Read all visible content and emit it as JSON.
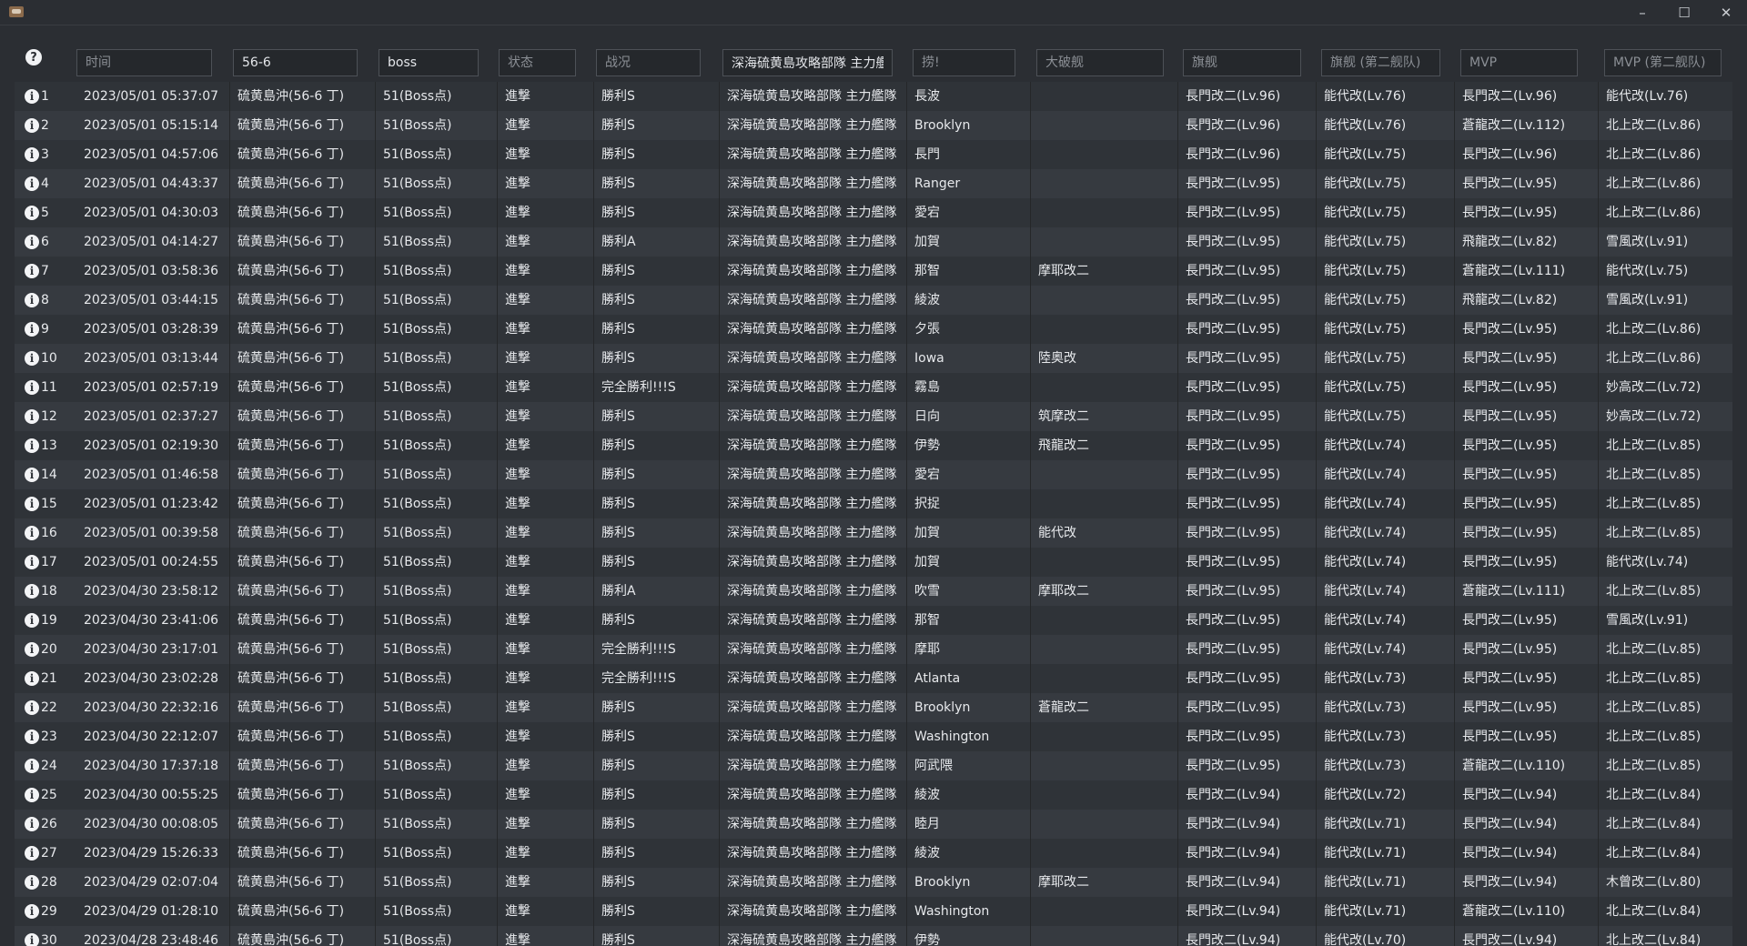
{
  "window": {
    "minimize_icon": "minimize-icon",
    "maximize_icon": "maximize-icon",
    "close_icon": "close-icon",
    "minimize": "–",
    "maximize": "☐",
    "close": "✕"
  },
  "filters": [
    {
      "name": "time",
      "placeholder": "时间",
      "value": ""
    },
    {
      "name": "map",
      "placeholder": "",
      "value": "56-6"
    },
    {
      "name": "node",
      "placeholder": "",
      "value": "boss"
    },
    {
      "name": "status",
      "placeholder": "状态",
      "value": ""
    },
    {
      "name": "result",
      "placeholder": "战况",
      "value": ""
    },
    {
      "name": "enemy",
      "placeholder": "",
      "value": "深海硫黄島攻略部隊 主力艦"
    },
    {
      "name": "drop",
      "placeholder": "捞!",
      "value": ""
    },
    {
      "name": "damaged",
      "placeholder": "大破舰",
      "value": ""
    },
    {
      "name": "flagship",
      "placeholder": "旗舰",
      "value": ""
    },
    {
      "name": "flagship2",
      "placeholder": "旗舰 (第二舰队)",
      "value": ""
    },
    {
      "name": "mvp",
      "placeholder": "MVP",
      "value": ""
    },
    {
      "name": "mvp2",
      "placeholder": "MVP (第二舰队)",
      "value": ""
    }
  ],
  "help_icon": "?",
  "info_icon": "i",
  "rows": [
    {
      "n": "1",
      "time": "2023/05/01 05:37:07",
      "map": "硫黄島沖(56-6 丁)",
      "node": "51(Boss点)",
      "status": "進撃",
      "result": "勝利S",
      "enemy": "深海硫黄島攻略部隊 主力艦隊",
      "drop": "長波",
      "damaged": "",
      "flag": "長門改二(Lv.96)",
      "flag2": "能代改(Lv.76)",
      "mvp": "長門改二(Lv.96)",
      "mvp2": "能代改(Lv.76)"
    },
    {
      "n": "2",
      "time": "2023/05/01 05:15:14",
      "map": "硫黄島沖(56-6 丁)",
      "node": "51(Boss点)",
      "status": "進撃",
      "result": "勝利S",
      "enemy": "深海硫黄島攻略部隊 主力艦隊",
      "drop": "Brooklyn",
      "damaged": "",
      "flag": "長門改二(Lv.96)",
      "flag2": "能代改(Lv.76)",
      "mvp": "蒼龍改二(Lv.112)",
      "mvp2": "北上改二(Lv.86)"
    },
    {
      "n": "3",
      "time": "2023/05/01 04:57:06",
      "map": "硫黄島沖(56-6 丁)",
      "node": "51(Boss点)",
      "status": "進撃",
      "result": "勝利S",
      "enemy": "深海硫黄島攻略部隊 主力艦隊",
      "drop": "長門",
      "damaged": "",
      "flag": "長門改二(Lv.96)",
      "flag2": "能代改(Lv.75)",
      "mvp": "長門改二(Lv.96)",
      "mvp2": "北上改二(Lv.86)"
    },
    {
      "n": "4",
      "time": "2023/05/01 04:43:37",
      "map": "硫黄島沖(56-6 丁)",
      "node": "51(Boss点)",
      "status": "進撃",
      "result": "勝利S",
      "enemy": "深海硫黄島攻略部隊 主力艦隊",
      "drop": "Ranger",
      "damaged": "",
      "flag": "長門改二(Lv.95)",
      "flag2": "能代改(Lv.75)",
      "mvp": "長門改二(Lv.95)",
      "mvp2": "北上改二(Lv.86)"
    },
    {
      "n": "5",
      "time": "2023/05/01 04:30:03",
      "map": "硫黄島沖(56-6 丁)",
      "node": "51(Boss点)",
      "status": "進撃",
      "result": "勝利S",
      "enemy": "深海硫黄島攻略部隊 主力艦隊",
      "drop": "愛宕",
      "damaged": "",
      "flag": "長門改二(Lv.95)",
      "flag2": "能代改(Lv.75)",
      "mvp": "長門改二(Lv.95)",
      "mvp2": "北上改二(Lv.86)"
    },
    {
      "n": "6",
      "time": "2023/05/01 04:14:27",
      "map": "硫黄島沖(56-6 丁)",
      "node": "51(Boss点)",
      "status": "進撃",
      "result": "勝利A",
      "enemy": "深海硫黄島攻略部隊 主力艦隊",
      "drop": "加賀",
      "damaged": "",
      "flag": "長門改二(Lv.95)",
      "flag2": "能代改(Lv.75)",
      "mvp": "飛龍改二(Lv.82)",
      "mvp2": "雪風改(Lv.91)"
    },
    {
      "n": "7",
      "time": "2023/05/01 03:58:36",
      "map": "硫黄島沖(56-6 丁)",
      "node": "51(Boss点)",
      "status": "進撃",
      "result": "勝利S",
      "enemy": "深海硫黄島攻略部隊 主力艦隊",
      "drop": "那智",
      "damaged": "摩耶改二",
      "flag": "長門改二(Lv.95)",
      "flag2": "能代改(Lv.75)",
      "mvp": "蒼龍改二(Lv.111)",
      "mvp2": "能代改(Lv.75)"
    },
    {
      "n": "8",
      "time": "2023/05/01 03:44:15",
      "map": "硫黄島沖(56-6 丁)",
      "node": "51(Boss点)",
      "status": "進撃",
      "result": "勝利S",
      "enemy": "深海硫黄島攻略部隊 主力艦隊",
      "drop": "綾波",
      "damaged": "",
      "flag": "長門改二(Lv.95)",
      "flag2": "能代改(Lv.75)",
      "mvp": "飛龍改二(Lv.82)",
      "mvp2": "雪風改(Lv.91)"
    },
    {
      "n": "9",
      "time": "2023/05/01 03:28:39",
      "map": "硫黄島沖(56-6 丁)",
      "node": "51(Boss点)",
      "status": "進撃",
      "result": "勝利S",
      "enemy": "深海硫黄島攻略部隊 主力艦隊",
      "drop": "夕張",
      "damaged": "",
      "flag": "長門改二(Lv.95)",
      "flag2": "能代改(Lv.75)",
      "mvp": "長門改二(Lv.95)",
      "mvp2": "北上改二(Lv.86)"
    },
    {
      "n": "10",
      "time": "2023/05/01 03:13:44",
      "map": "硫黄島沖(56-6 丁)",
      "node": "51(Boss点)",
      "status": "進撃",
      "result": "勝利S",
      "enemy": "深海硫黄島攻略部隊 主力艦隊",
      "drop": "Iowa",
      "damaged": "陸奥改",
      "flag": "長門改二(Lv.95)",
      "flag2": "能代改(Lv.75)",
      "mvp": "長門改二(Lv.95)",
      "mvp2": "北上改二(Lv.86)"
    },
    {
      "n": "11",
      "time": "2023/05/01 02:57:19",
      "map": "硫黄島沖(56-6 丁)",
      "node": "51(Boss点)",
      "status": "進撃",
      "result": "完全勝利!!!S",
      "enemy": "深海硫黄島攻略部隊 主力艦隊",
      "drop": "霧島",
      "damaged": "",
      "flag": "長門改二(Lv.95)",
      "flag2": "能代改(Lv.75)",
      "mvp": "長門改二(Lv.95)",
      "mvp2": "妙高改二(Lv.72)"
    },
    {
      "n": "12",
      "time": "2023/05/01 02:37:27",
      "map": "硫黄島沖(56-6 丁)",
      "node": "51(Boss点)",
      "status": "進撃",
      "result": "勝利S",
      "enemy": "深海硫黄島攻略部隊 主力艦隊",
      "drop": "日向",
      "damaged": "筑摩改二",
      "flag": "長門改二(Lv.95)",
      "flag2": "能代改(Lv.75)",
      "mvp": "長門改二(Lv.95)",
      "mvp2": "妙高改二(Lv.72)"
    },
    {
      "n": "13",
      "time": "2023/05/01 02:19:30",
      "map": "硫黄島沖(56-6 丁)",
      "node": "51(Boss点)",
      "status": "進撃",
      "result": "勝利S",
      "enemy": "深海硫黄島攻略部隊 主力艦隊",
      "drop": "伊勢",
      "damaged": "飛龍改二",
      "flag": "長門改二(Lv.95)",
      "flag2": "能代改(Lv.74)",
      "mvp": "長門改二(Lv.95)",
      "mvp2": "北上改二(Lv.85)"
    },
    {
      "n": "14",
      "time": "2023/05/01 01:46:58",
      "map": "硫黄島沖(56-6 丁)",
      "node": "51(Boss点)",
      "status": "進撃",
      "result": "勝利S",
      "enemy": "深海硫黄島攻略部隊 主力艦隊",
      "drop": "愛宕",
      "damaged": "",
      "flag": "長門改二(Lv.95)",
      "flag2": "能代改(Lv.74)",
      "mvp": "長門改二(Lv.95)",
      "mvp2": "北上改二(Lv.85)"
    },
    {
      "n": "15",
      "time": "2023/05/01 01:23:42",
      "map": "硫黄島沖(56-6 丁)",
      "node": "51(Boss点)",
      "status": "進撃",
      "result": "勝利S",
      "enemy": "深海硫黄島攻略部隊 主力艦隊",
      "drop": "択捉",
      "damaged": "",
      "flag": "長門改二(Lv.95)",
      "flag2": "能代改(Lv.74)",
      "mvp": "長門改二(Lv.95)",
      "mvp2": "北上改二(Lv.85)"
    },
    {
      "n": "16",
      "time": "2023/05/01 00:39:58",
      "map": "硫黄島沖(56-6 丁)",
      "node": "51(Boss点)",
      "status": "進撃",
      "result": "勝利S",
      "enemy": "深海硫黄島攻略部隊 主力艦隊",
      "drop": "加賀",
      "damaged": "能代改",
      "flag": "長門改二(Lv.95)",
      "flag2": "能代改(Lv.74)",
      "mvp": "長門改二(Lv.95)",
      "mvp2": "北上改二(Lv.85)"
    },
    {
      "n": "17",
      "time": "2023/05/01 00:24:55",
      "map": "硫黄島沖(56-6 丁)",
      "node": "51(Boss点)",
      "status": "進撃",
      "result": "勝利S",
      "enemy": "深海硫黄島攻略部隊 主力艦隊",
      "drop": "加賀",
      "damaged": "",
      "flag": "長門改二(Lv.95)",
      "flag2": "能代改(Lv.74)",
      "mvp": "長門改二(Lv.95)",
      "mvp2": "能代改(Lv.74)"
    },
    {
      "n": "18",
      "time": "2023/04/30 23:58:12",
      "map": "硫黄島沖(56-6 丁)",
      "node": "51(Boss点)",
      "status": "進撃",
      "result": "勝利A",
      "enemy": "深海硫黄島攻略部隊 主力艦隊",
      "drop": "吹雪",
      "damaged": "摩耶改二",
      "flag": "長門改二(Lv.95)",
      "flag2": "能代改(Lv.74)",
      "mvp": "蒼龍改二(Lv.111)",
      "mvp2": "北上改二(Lv.85)"
    },
    {
      "n": "19",
      "time": "2023/04/30 23:41:06",
      "map": "硫黄島沖(56-6 丁)",
      "node": "51(Boss点)",
      "status": "進撃",
      "result": "勝利S",
      "enemy": "深海硫黄島攻略部隊 主力艦隊",
      "drop": "那智",
      "damaged": "",
      "flag": "長門改二(Lv.95)",
      "flag2": "能代改(Lv.74)",
      "mvp": "長門改二(Lv.95)",
      "mvp2": "雪風改(Lv.91)"
    },
    {
      "n": "20",
      "time": "2023/04/30 23:17:01",
      "map": "硫黄島沖(56-6 丁)",
      "node": "51(Boss点)",
      "status": "進撃",
      "result": "完全勝利!!!S",
      "enemy": "深海硫黄島攻略部隊 主力艦隊",
      "drop": "摩耶",
      "damaged": "",
      "flag": "長門改二(Lv.95)",
      "flag2": "能代改(Lv.74)",
      "mvp": "長門改二(Lv.95)",
      "mvp2": "北上改二(Lv.85)"
    },
    {
      "n": "21",
      "time": "2023/04/30 23:02:28",
      "map": "硫黄島沖(56-6 丁)",
      "node": "51(Boss点)",
      "status": "進撃",
      "result": "完全勝利!!!S",
      "enemy": "深海硫黄島攻略部隊 主力艦隊",
      "drop": "Atlanta",
      "damaged": "",
      "flag": "長門改二(Lv.95)",
      "flag2": "能代改(Lv.73)",
      "mvp": "長門改二(Lv.95)",
      "mvp2": "北上改二(Lv.85)"
    },
    {
      "n": "22",
      "time": "2023/04/30 22:32:16",
      "map": "硫黄島沖(56-6 丁)",
      "node": "51(Boss点)",
      "status": "進撃",
      "result": "勝利S",
      "enemy": "深海硫黄島攻略部隊 主力艦隊",
      "drop": "Brooklyn",
      "damaged": "蒼龍改二",
      "flag": "長門改二(Lv.95)",
      "flag2": "能代改(Lv.73)",
      "mvp": "長門改二(Lv.95)",
      "mvp2": "北上改二(Lv.85)"
    },
    {
      "n": "23",
      "time": "2023/04/30 22:12:07",
      "map": "硫黄島沖(56-6 丁)",
      "node": "51(Boss点)",
      "status": "進撃",
      "result": "勝利S",
      "enemy": "深海硫黄島攻略部隊 主力艦隊",
      "drop": "Washington",
      "damaged": "",
      "flag": "長門改二(Lv.95)",
      "flag2": "能代改(Lv.73)",
      "mvp": "長門改二(Lv.95)",
      "mvp2": "北上改二(Lv.85)"
    },
    {
      "n": "24",
      "time": "2023/04/30 17:37:18",
      "map": "硫黄島沖(56-6 丁)",
      "node": "51(Boss点)",
      "status": "進撃",
      "result": "勝利S",
      "enemy": "深海硫黄島攻略部隊 主力艦隊",
      "drop": "阿武隈",
      "damaged": "",
      "flag": "長門改二(Lv.95)",
      "flag2": "能代改(Lv.73)",
      "mvp": "蒼龍改二(Lv.110)",
      "mvp2": "北上改二(Lv.85)"
    },
    {
      "n": "25",
      "time": "2023/04/30 00:55:25",
      "map": "硫黄島沖(56-6 丁)",
      "node": "51(Boss点)",
      "status": "進撃",
      "result": "勝利S",
      "enemy": "深海硫黄島攻略部隊 主力艦隊",
      "drop": "綾波",
      "damaged": "",
      "flag": "長門改二(Lv.94)",
      "flag2": "能代改(Lv.72)",
      "mvp": "長門改二(Lv.94)",
      "mvp2": "北上改二(Lv.84)"
    },
    {
      "n": "26",
      "time": "2023/04/30 00:08:05",
      "map": "硫黄島沖(56-6 丁)",
      "node": "51(Boss点)",
      "status": "進撃",
      "result": "勝利S",
      "enemy": "深海硫黄島攻略部隊 主力艦隊",
      "drop": "睦月",
      "damaged": "",
      "flag": "長門改二(Lv.94)",
      "flag2": "能代改(Lv.71)",
      "mvp": "長門改二(Lv.94)",
      "mvp2": "北上改二(Lv.84)"
    },
    {
      "n": "27",
      "time": "2023/04/29 15:26:33",
      "map": "硫黄島沖(56-6 丁)",
      "node": "51(Boss点)",
      "status": "進撃",
      "result": "勝利S",
      "enemy": "深海硫黄島攻略部隊 主力艦隊",
      "drop": "綾波",
      "damaged": "",
      "flag": "長門改二(Lv.94)",
      "flag2": "能代改(Lv.71)",
      "mvp": "長門改二(Lv.94)",
      "mvp2": "北上改二(Lv.84)"
    },
    {
      "n": "28",
      "time": "2023/04/29 02:07:04",
      "map": "硫黄島沖(56-6 丁)",
      "node": "51(Boss点)",
      "status": "進撃",
      "result": "勝利S",
      "enemy": "深海硫黄島攻略部隊 主力艦隊",
      "drop": "Brooklyn",
      "damaged": "摩耶改二",
      "flag": "長門改二(Lv.94)",
      "flag2": "能代改(Lv.71)",
      "mvp": "長門改二(Lv.94)",
      "mvp2": "木曾改二(Lv.80)"
    },
    {
      "n": "29",
      "time": "2023/04/29 01:28:10",
      "map": "硫黄島沖(56-6 丁)",
      "node": "51(Boss点)",
      "status": "進撃",
      "result": "勝利S",
      "enemy": "深海硫黄島攻略部隊 主力艦隊",
      "drop": "Washington",
      "damaged": "",
      "flag": "長門改二(Lv.94)",
      "flag2": "能代改(Lv.71)",
      "mvp": "蒼龍改二(Lv.110)",
      "mvp2": "北上改二(Lv.84)"
    },
    {
      "n": "30",
      "time": "2023/04/28 23:48:46",
      "map": "硫黄島沖(56-6 丁)",
      "node": "51(Boss点)",
      "status": "進撃",
      "result": "勝利S",
      "enemy": "深海硫黄島攻略部隊 主力艦隊",
      "drop": "伊勢",
      "damaged": "",
      "flag": "長門改二(Lv.94)",
      "flag2": "能代改(Lv.70)",
      "mvp": "長門改二(Lv.94)",
      "mvp2": "北上改二(Lv.84)"
    }
  ]
}
